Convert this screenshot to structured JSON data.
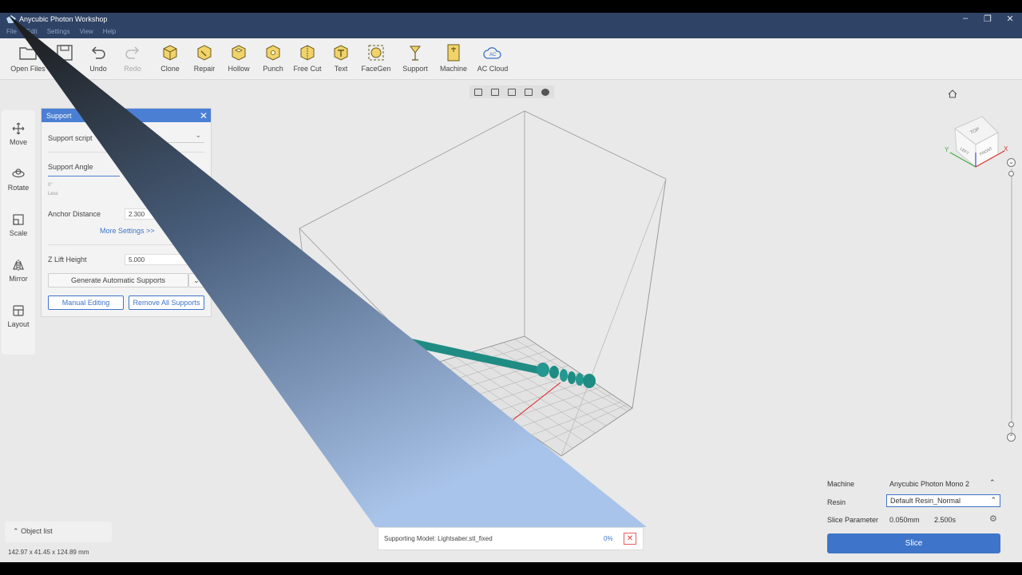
{
  "window": {
    "title": "Anycubic Photon Workshop"
  },
  "menu": [
    "File",
    "Edit",
    "Settings",
    "View",
    "Help"
  ],
  "toolbar": [
    {
      "id": "open-files",
      "label": "Open Files",
      "icon": "folder-icon",
      "disabled": false
    },
    {
      "id": "save",
      "label": "Save",
      "icon": "save-icon",
      "disabled": false
    },
    {
      "id": "undo",
      "label": "Undo",
      "icon": "undo-icon",
      "disabled": false
    },
    {
      "id": "redo",
      "label": "Redo",
      "icon": "redo-icon",
      "disabled": true
    },
    {
      "id": "clone",
      "label": "Clone",
      "icon": "clone-icon",
      "disabled": false
    },
    {
      "id": "repair",
      "label": "Repair",
      "icon": "repair-icon",
      "disabled": false
    },
    {
      "id": "hollow",
      "label": "Hollow",
      "icon": "hollow-icon",
      "disabled": false
    },
    {
      "id": "punch",
      "label": "Punch",
      "icon": "punch-icon",
      "disabled": false
    },
    {
      "id": "free-cut",
      "label": "Free Cut",
      "icon": "free-cut-icon",
      "disabled": false
    },
    {
      "id": "text",
      "label": "Text",
      "icon": "text-icon",
      "disabled": false
    },
    {
      "id": "facegen",
      "label": "FaceGen",
      "icon": "facegen-icon",
      "disabled": false
    },
    {
      "id": "support",
      "label": "Support",
      "icon": "support-icon",
      "disabled": false
    },
    {
      "id": "machine",
      "label": "Machine",
      "icon": "machine-icon",
      "disabled": false
    },
    {
      "id": "ac-cloud",
      "label": "AC Cloud",
      "icon": "cloud-icon",
      "disabled": false
    }
  ],
  "left_tools": [
    {
      "id": "move",
      "label": "Move",
      "icon": "move-icon"
    },
    {
      "id": "rotate",
      "label": "Rotate",
      "icon": "rotate-icon"
    },
    {
      "id": "scale",
      "label": "Scale",
      "icon": "scale-icon"
    },
    {
      "id": "mirror",
      "label": "Mirror",
      "icon": "mirror-icon"
    },
    {
      "id": "layout",
      "label": "Layout",
      "icon": "layout-icon"
    }
  ],
  "support_panel": {
    "title": "Support",
    "support_script_label": "Support script",
    "support_angle_label": "Support Angle",
    "angle_min": "0°",
    "angle_less": "Less",
    "anchor_distance_label": "Anchor Distance",
    "anchor_distance_value": "2.300",
    "more_settings": "More Settings >>",
    "z_lift_label": "Z Lift Height",
    "z_lift_value": "5.000",
    "generate_button": "Generate Automatic Supports",
    "manual_button": "Manual Editing",
    "remove_button": "Remove All Supports"
  },
  "viewcube": {
    "top": "TOP",
    "left": "LEFT",
    "front": "FRONT",
    "x": "X",
    "y": "Y"
  },
  "object_list": {
    "label": "Object list"
  },
  "dimensions": "142.97 x 41.45 x 124.89 mm",
  "progress": {
    "message": "Supporting Model: Lightsaber.stl_fixed",
    "percent": "0%",
    "close": "✕"
  },
  "machine_panel": {
    "machine_label": "Machine",
    "machine_value": "Anycubic Photon Mono 2",
    "resin_label": "Resin",
    "resin_value": "Default Resin_Normal",
    "slice_param_label": "Slice Parameter",
    "layer_height": "0.050mm",
    "exposure": "2.500s",
    "slice_button": "Slice"
  },
  "colors": {
    "accent": "#3e74c9",
    "model": "#1f8c84",
    "titlebar": "#2f4366"
  }
}
